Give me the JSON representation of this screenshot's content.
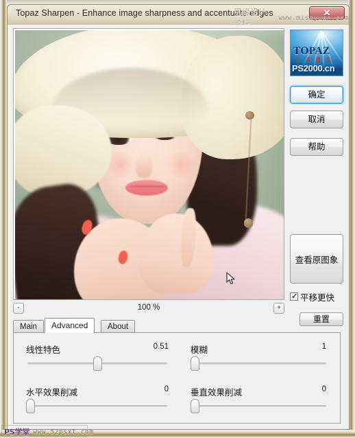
{
  "window": {
    "title": "Topaz Sharpen - Enhance image sharpness and accentuate edges",
    "close_label": "✕",
    "frame_accent": "#9c874f"
  },
  "watermarks": {
    "top_cn": "思缘设计论坛",
    "top_url": "www.missyuan.com",
    "bottom_cn": "PS学堂",
    "bottom_url": "www.52psxt.com",
    "logo_overlay": "PS2000.cn"
  },
  "preview": {
    "name": "image-preview",
    "alt": "Portrait photo of a young woman wearing a white straw hat"
  },
  "zoom": {
    "out_label": "-",
    "in_label": "+",
    "level": "100 %"
  },
  "tabs": [
    {
      "id": "main",
      "label": "Main",
      "active": false
    },
    {
      "id": "advanced",
      "label": "Advanced",
      "active": true
    },
    {
      "id": "about",
      "label": "About",
      "active": false
    }
  ],
  "sliders": [
    {
      "id": "linear-feature",
      "label": "线性特色",
      "value": "0.51",
      "percent": 51
    },
    {
      "id": "blur",
      "label": "模糊",
      "value": "1",
      "percent": 2
    },
    {
      "id": "horizontal-cut",
      "label": "水平效果削减",
      "value": "0",
      "percent": 1
    },
    {
      "id": "vertical-cut",
      "label": "垂直效果削减",
      "value": "0",
      "percent": 1
    }
  ],
  "sidebar": {
    "logo": {
      "brand": "TOPAZ",
      "sub": "L A B S"
    },
    "buttons": {
      "ok": "确定",
      "cancel": "取消",
      "help": "帮助",
      "view_original": "查看原图象",
      "reset": "重置"
    },
    "checkbox": {
      "label": "平移更快",
      "checked": true
    }
  },
  "colors": {
    "accent_blue": "#2f97d4",
    "panel_bg": "#f0f0f0",
    "title_bg": "#e8e2d2"
  }
}
